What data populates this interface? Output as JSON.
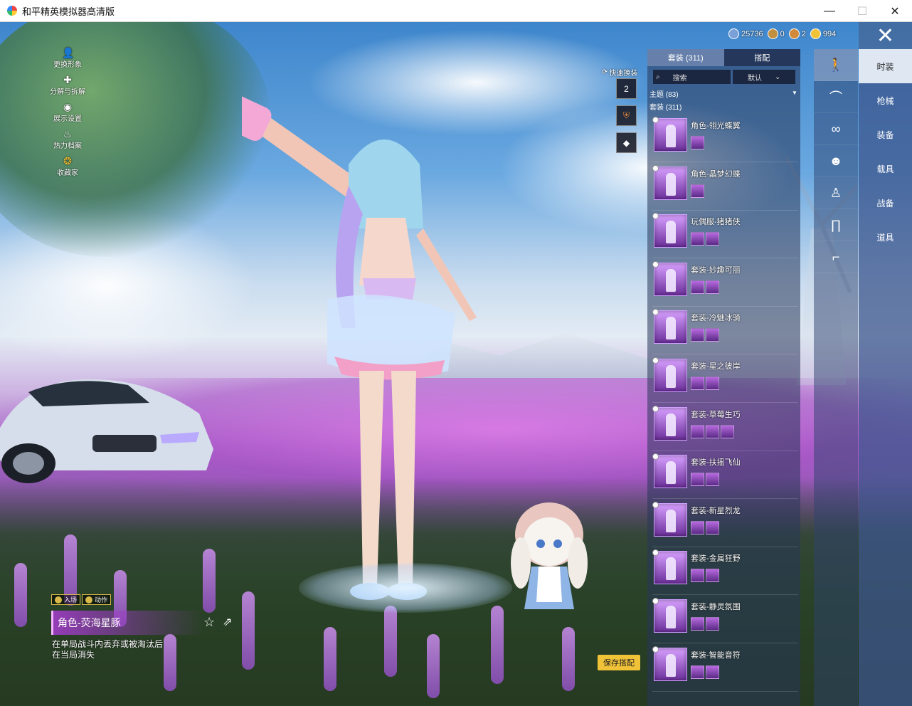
{
  "window": {
    "title": "和平精英模拟器高清版",
    "minimize": "—",
    "maximize": "☐",
    "close": "✕"
  },
  "currency": [
    {
      "icon": "globe-coin-icon",
      "value": "25736",
      "color": "#7aa0d8"
    },
    {
      "icon": "a-coin-icon",
      "value": "0",
      "color": "#c09040"
    },
    {
      "icon": "medal-coin-icon",
      "value": "2",
      "color": "#d08a3a"
    },
    {
      "icon": "gold-coin-icon",
      "value": "994",
      "color": "#f0c238"
    }
  ],
  "close_button": "✕",
  "side_menu": [
    {
      "icon": "profile-icon",
      "label": "更换形象"
    },
    {
      "icon": "puzzle-icon",
      "label": "分解与拆解"
    },
    {
      "icon": "eye-icon",
      "label": "展示设置"
    },
    {
      "icon": "flame-icon",
      "label": "热力档案"
    },
    {
      "icon": "collector-icon",
      "label": "收藏家"
    }
  ],
  "quick_change": {
    "label": "快速换装",
    "slot1": "2"
  },
  "list_panel": {
    "tabs": [
      {
        "label": "套装 (311)",
        "active": true
      },
      {
        "label": "搭配",
        "active": false
      }
    ],
    "search_placeholder": "搜索",
    "sort_label": "默认",
    "theme_header": "主题 (83)",
    "suit_header": "套装 (311)",
    "items": [
      {
        "name": "角色-翎光蝶翼",
        "subicons": 1
      },
      {
        "name": "角色-晶梦幻蝶",
        "subicons": 1
      },
      {
        "name": "玩偶服-猪猪侠",
        "subicons": 2
      },
      {
        "name": "套装-妙趣可丽",
        "subicons": 2
      },
      {
        "name": "套装-冷魅冰骑",
        "subicons": 2
      },
      {
        "name": "套装-星之彼岸",
        "subicons": 2
      },
      {
        "name": "套装-草莓生巧",
        "subicons": 3
      },
      {
        "name": "套装-扶摇飞仙",
        "subicons": 2
      },
      {
        "name": "套装-新星烈龙",
        "subicons": 2
      },
      {
        "name": "套装-金属狂野",
        "subicons": 2
      },
      {
        "name": "套装-静灵氛围",
        "subicons": 2
      },
      {
        "name": "套装-智能音符",
        "subicons": 2
      }
    ]
  },
  "category_icons": [
    {
      "icon": "character-icon",
      "active": true
    },
    {
      "icon": "cap-icon",
      "active": false
    },
    {
      "icon": "glasses-icon",
      "active": false
    },
    {
      "icon": "mask-icon",
      "active": false
    },
    {
      "icon": "body-suit-icon",
      "active": false
    },
    {
      "icon": "pants-icon",
      "active": false
    },
    {
      "icon": "socks-icon",
      "active": false
    }
  ],
  "right_tabs": [
    {
      "label": "时装",
      "active": true
    },
    {
      "label": "枪械",
      "active": false
    },
    {
      "label": "装备",
      "active": false
    },
    {
      "label": "载具",
      "active": false
    },
    {
      "label": "战备",
      "active": false
    },
    {
      "label": "道具",
      "active": false
    }
  ],
  "selected_item": {
    "emote_buttons": [
      "入场",
      "动作"
    ],
    "name": "角色-荧海星豚",
    "description": "在单局战斗内丢弃或被淘汰后在当局消失"
  },
  "save_button": "保存搭配"
}
